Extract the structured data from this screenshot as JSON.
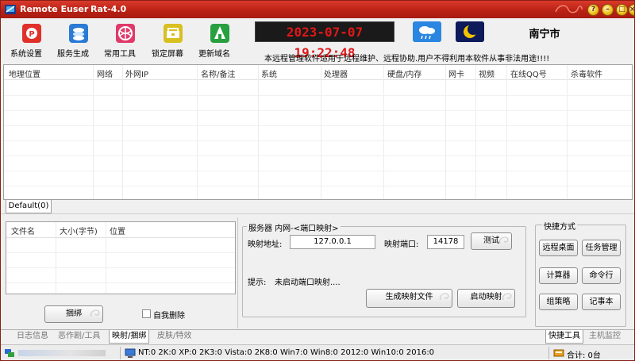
{
  "window": {
    "app_name": "Remote Euser",
    "version": "Rat-4.0"
  },
  "toolbar": {
    "items": [
      {
        "label": "系统设置",
        "icon": "settings-icon",
        "color": "#e0302a"
      },
      {
        "label": "服务生成",
        "icon": "service-icon",
        "color": "#2a7ad6"
      },
      {
        "label": "常用工具",
        "icon": "tools-icon",
        "color": "#e03a6a"
      },
      {
        "label": "锁定屏幕",
        "icon": "lock-screen-icon",
        "color": "#d8c020"
      },
      {
        "label": "更新域名",
        "icon": "update-domain-icon",
        "color": "#28a040"
      }
    ],
    "clock": "2023-07-07 19:22:48",
    "city": "南宁市",
    "notice": "本远程管理软件适用于远程维护、远程协助.用户不得利用本软件从事非法用途!!!!"
  },
  "host_list": {
    "columns": [
      "地理位置",
      "网络",
      "外网IP",
      "名称/备注",
      "系统",
      "处理器",
      "硬盘/内存",
      "网卡",
      "视频",
      "在线QQ号",
      "杀毒软件"
    ],
    "group_tab": "Default(0)"
  },
  "file_list": {
    "columns": [
      "文件名",
      "大小(字节)",
      "位置"
    ],
    "bind_button": "捆绑",
    "self_delete_label": "自我删除"
  },
  "mapping": {
    "group_title": "服务器 内网-<端口映射>",
    "address_label": "映射地址:",
    "address_value": "127.0.0.1",
    "port_label": "映射端口:",
    "port_value": "14178",
    "test_button": "测试",
    "hint_label": "提示:",
    "hint_text": "未启动端口映射....",
    "generate_button": "生成映射文件",
    "start_button": "启动映射"
  },
  "shortcuts": {
    "title": "快捷方式",
    "buttons": [
      "远程桌面",
      "任务管理",
      "计算器",
      "命令行",
      "组策略",
      "记事本"
    ]
  },
  "bottom_tabs": {
    "left": [
      "日志信息",
      "恶作剧/工具",
      "映射/捆绑",
      "皮肤/特效"
    ],
    "right": [
      "快捷工具",
      "主机监控"
    ]
  },
  "status": {
    "counts": "NT:0  2K:0  XP:0  2K3:0  Vista:0  2K8:0  Win7:0  Win8:0  2012:0  Win10:0  2016:0",
    "total": "合计: 0台"
  }
}
